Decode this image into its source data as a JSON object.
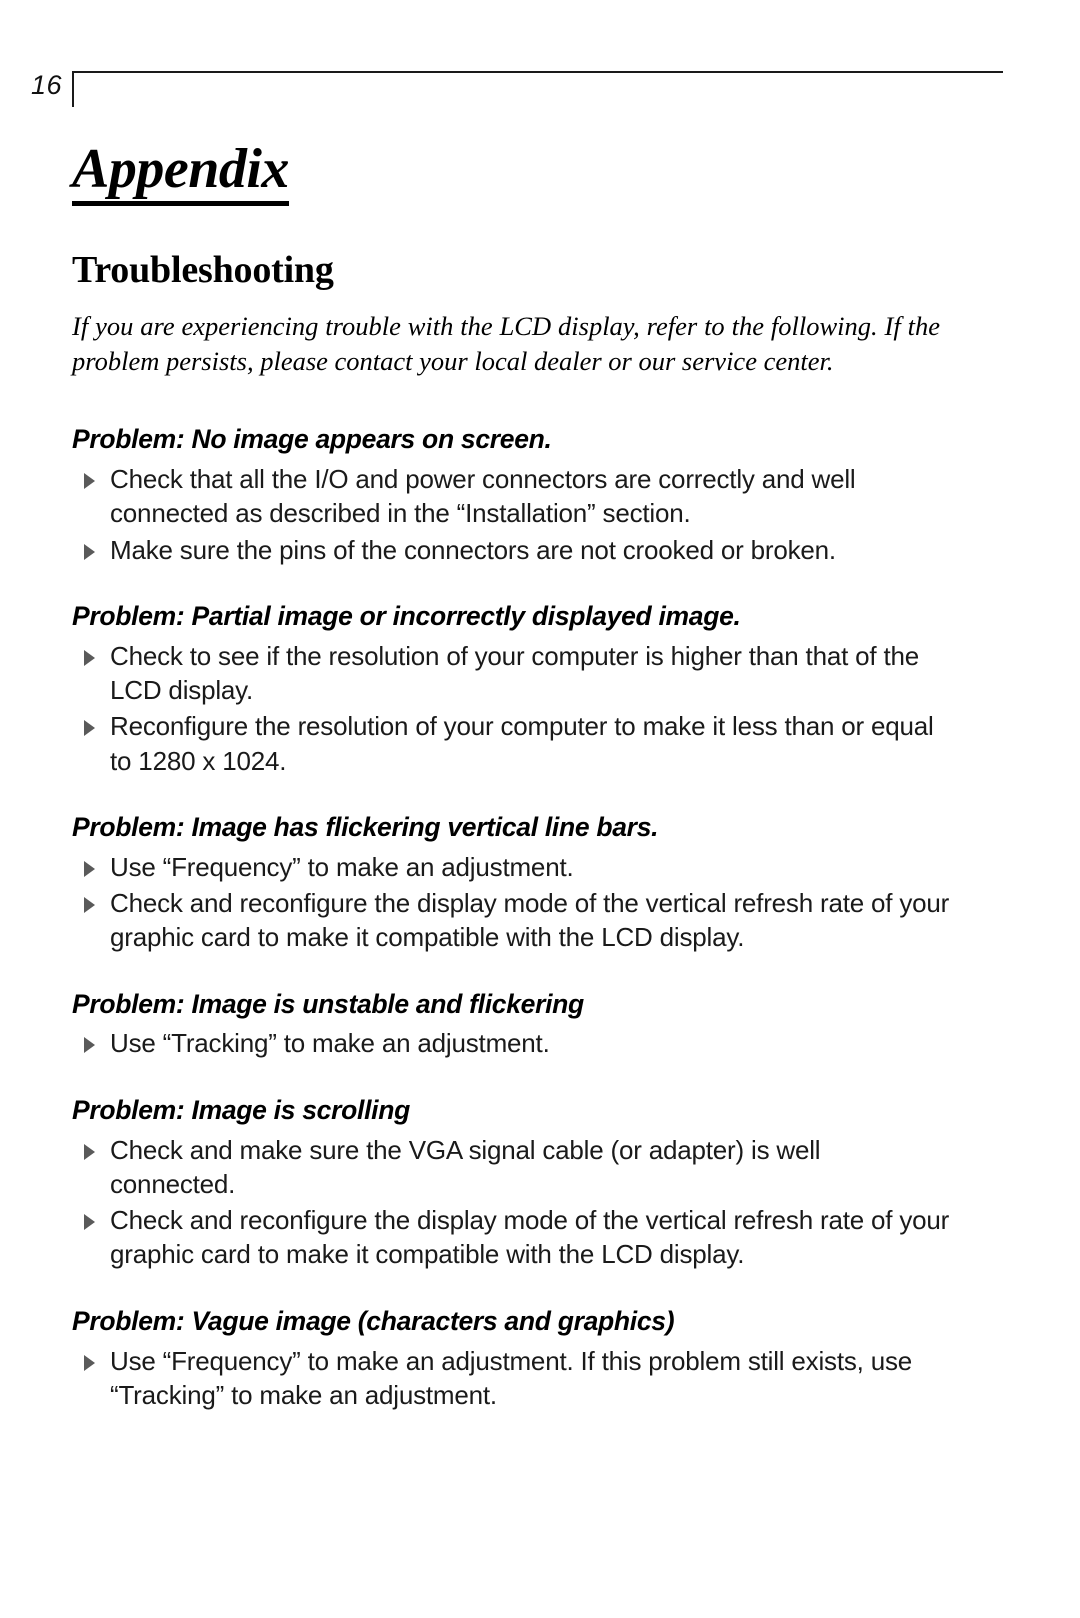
{
  "page": {
    "folio": "16",
    "appendix_title": "Appendix",
    "section_title": "Troubleshooting",
    "intro": "If you are experiencing trouble with the LCD display, refer to the following. If the problem persists, please contact your local dealer or our service center."
  },
  "problems": [
    {
      "heading": "Problem: No image appears on screen.",
      "items": [
        "Check that all the I/O and power connectors are correctly and well connected as described in the “Installation” section.",
        "Make sure the pins of the connectors are not crooked or broken."
      ]
    },
    {
      "heading": "Problem: Partial image or incorrectly displayed image.",
      "items": [
        "Check to see if the resolution of your computer is higher than that of the LCD display.",
        "Reconfigure the resolution of your computer to make it less than or equal to 1280 x 1024."
      ]
    },
    {
      "heading": "Problem: Image has flickering vertical line bars.",
      "items": [
        "Use “Frequency” to make an adjustment.",
        "Check and reconfigure the display mode of the vertical refresh rate of your graphic card to make it compatible with the LCD display."
      ]
    },
    {
      "heading": "Problem: Image is unstable and flickering",
      "items": [
        "Use “Tracking” to make an adjustment."
      ]
    },
    {
      "heading": "Problem: Image is scrolling",
      "items": [
        "Check and make sure the VGA signal cable (or adapter) is well connected.",
        "Check and reconfigure the display mode of the vertical refresh rate of your graphic card to make it compatible with the LCD display."
      ]
    },
    {
      "heading": "Problem: Vague image (characters and graphics)",
      "items": [
        "Use “Frequency” to make an adjustment. If this problem still exists, use “Tracking” to make an adjustment."
      ]
    }
  ],
  "colors": {
    "text": "#000000",
    "bullet_marker": "#5a5a5a",
    "rule": "#1a1a1a"
  }
}
